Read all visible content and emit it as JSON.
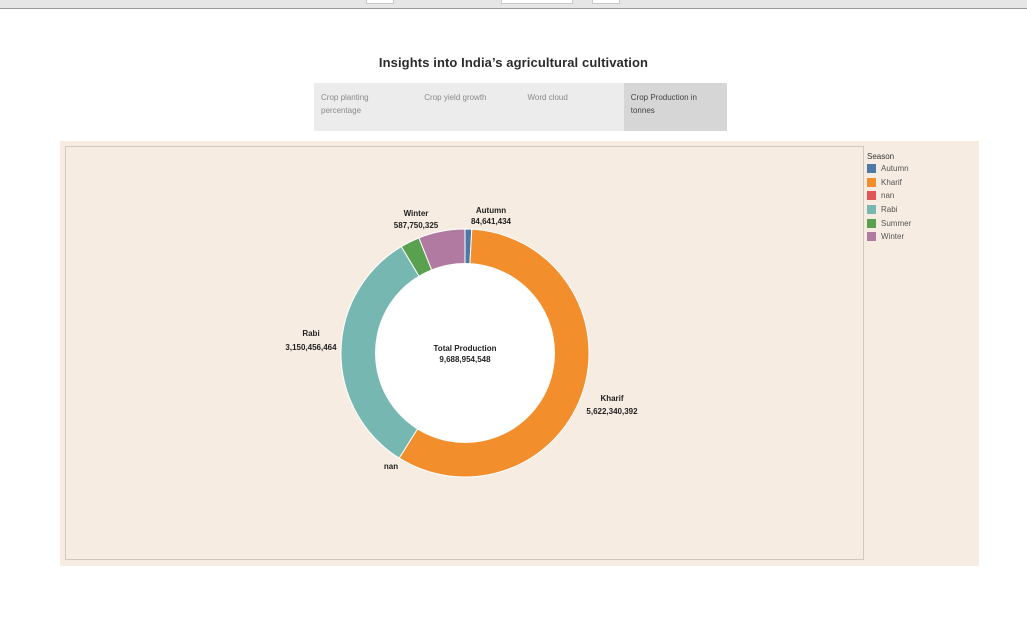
{
  "title": "Insights into India’s agricultural cultivation",
  "tabs": [
    {
      "label": "Crop planting percentage",
      "active": false
    },
    {
      "label": "Crop yield growth",
      "active": false
    },
    {
      "label": "Word cloud",
      "active": false
    },
    {
      "label": "Crop Production in tonnes",
      "active": true
    }
  ],
  "legend": {
    "title": "Season",
    "items": [
      {
        "label": "Autumn",
        "color": "#4e79a7"
      },
      {
        "label": "Kharif",
        "color": "#f28e2b"
      },
      {
        "label": "nan",
        "color": "#e15759"
      },
      {
        "label": "Rabi",
        "color": "#76b7b2"
      },
      {
        "label": "Summer",
        "color": "#59a14f"
      },
      {
        "label": "Winter",
        "color": "#b07aa1"
      }
    ]
  },
  "center": {
    "title": "Total Production",
    "value": "9,688,954,548"
  },
  "chart_data": {
    "type": "pie",
    "subtype": "donut",
    "slices": [
      {
        "name": "Autumn",
        "value": 84641434,
        "label": "84,641,434",
        "color": "#4e79a7"
      },
      {
        "name": "Kharif",
        "value": 5622340392,
        "label": "5,622,340,392",
        "color": "#f28e2b"
      },
      {
        "name": "nan",
        "value": 0,
        "label": "",
        "color": "#e15759"
      },
      {
        "name": "Rabi",
        "value": 3150456464,
        "label": "3,150,456,464",
        "color": "#76b7b2"
      },
      {
        "name": "Summer",
        "value": 243766000,
        "label": "",
        "color": "#59a14f"
      },
      {
        "name": "Winter",
        "value": 587750325,
        "label": "587,750,325",
        "color": "#b07aa1"
      }
    ],
    "total": 9688954548,
    "total_label": "9,688,954,548",
    "legend_position": "right"
  }
}
